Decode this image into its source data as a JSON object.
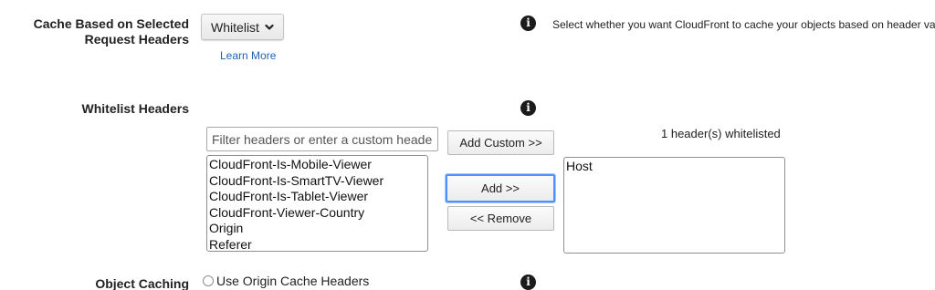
{
  "cache_section": {
    "label_line1": "Cache Based on Selected",
    "label_line2": "Request Headers",
    "dropdown_value": "Whitelist",
    "learn_more": "Learn More",
    "help_text": "Select whether you want CloudFront to cache your objects based on header valu"
  },
  "whitelist_section": {
    "label": "Whitelist Headers",
    "filter_placeholder": "Filter headers or enter a custom header",
    "add_custom_label": "Add Custom >>",
    "add_label": "Add >>",
    "remove_label": "<< Remove",
    "count_text": "1 header(s) whitelisted",
    "available_headers": [
      "CloudFront-Is-Mobile-Viewer",
      "CloudFront-Is-SmartTV-Viewer",
      "CloudFront-Is-Tablet-Viewer",
      "CloudFront-Viewer-Country",
      "Origin",
      "Referer"
    ],
    "selected_headers": [
      "Host"
    ]
  },
  "object_caching": {
    "label": "Object Caching",
    "option_label": "Use Origin Cache Headers"
  },
  "icons": {
    "info": "info-icon",
    "chevron": "chevron-down-icon"
  },
  "colors": {
    "link": "#1d63b8",
    "focus_ring": "#4d90fe"
  }
}
